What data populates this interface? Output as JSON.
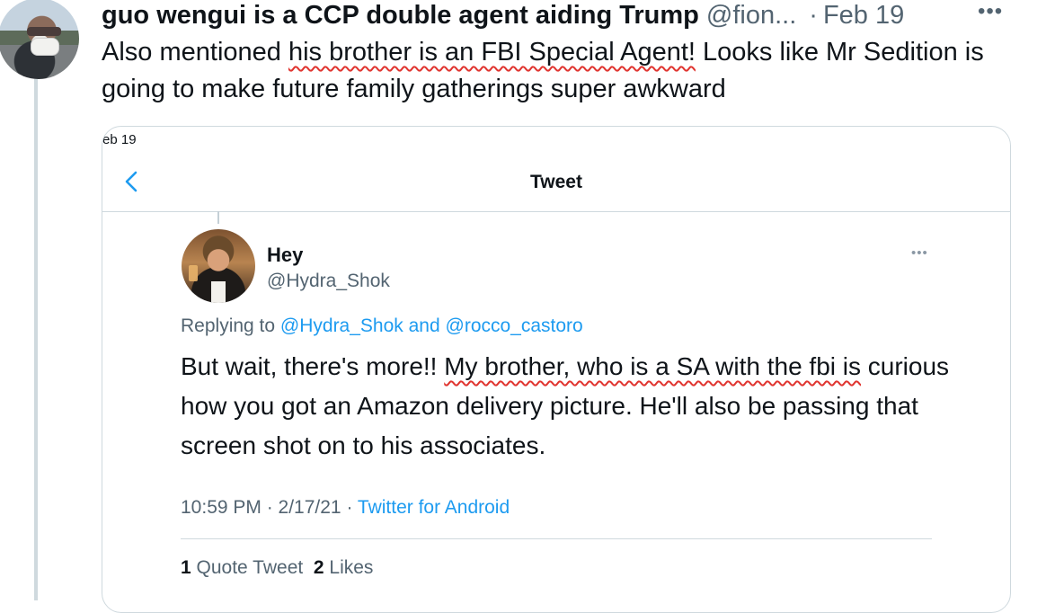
{
  "post": {
    "author_name": "guo wengui is a CCP double agent aiding Trump",
    "author_handle": "@fion...",
    "separator": "·",
    "date": "Feb 19",
    "more": "•••",
    "text_before": "Also mentioned ",
    "text_highlight": "his brother is an FBI Special Agent!",
    "text_after": " Looks like Mr Sedition is going to make future family gatherings super awkward"
  },
  "embedded": {
    "partial_date": "eb 19",
    "nav_title": "Tweet",
    "tweet": {
      "name": "Hey",
      "handle": "@Hydra_Shok",
      "more": "•••",
      "replying_prefix": "Replying to ",
      "reply_user_1": "@Hydra_Shok",
      "reply_and": " and ",
      "reply_user_2": "@rocco_castoro",
      "body_before": "But wait, there's more!!  ",
      "body_highlight": "My brother, who is a SA with the fbi is",
      "body_after": " curious how you got an Amazon delivery picture.  He'll also be passing that screen shot on to his associates.",
      "time": "10:59 PM · 2/17/21 · ",
      "source": "Twitter for Android",
      "quote_count": "1",
      "quote_label": " Quote Tweet",
      "like_count": "2",
      "like_label": " Likes"
    }
  },
  "colors": {
    "link": "#1d9bf0",
    "muted": "#536471",
    "highlight_underline": "#e0342f"
  }
}
